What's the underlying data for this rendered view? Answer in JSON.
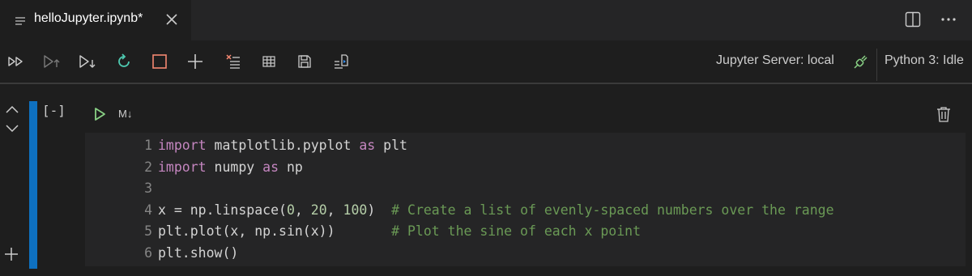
{
  "tab": {
    "title": "helloJupyter.ipynb*"
  },
  "toolbar": {
    "jupyter_server": "Jupyter Server: local",
    "kernel": "Python 3: Idle",
    "colors": {
      "restart": "#4ec9b0",
      "interrupt": "#f48771"
    }
  },
  "cell": {
    "execution_count": "[-]",
    "cell_type_toggle": "M↓",
    "code_lines": [
      {
        "number": "1",
        "tokens": [
          {
            "t": "import",
            "c": "kw"
          },
          {
            "t": " matplotlib.pyplot ",
            "c": ""
          },
          {
            "t": "as",
            "c": "kw"
          },
          {
            "t": " plt",
            "c": ""
          }
        ]
      },
      {
        "number": "2",
        "tokens": [
          {
            "t": "import",
            "c": "kw"
          },
          {
            "t": " numpy ",
            "c": ""
          },
          {
            "t": "as",
            "c": "kw"
          },
          {
            "t": " np",
            "c": ""
          }
        ]
      },
      {
        "number": "3",
        "tokens": []
      },
      {
        "number": "4",
        "tokens": [
          {
            "t": "x = np.linspace(",
            "c": ""
          },
          {
            "t": "0",
            "c": "num"
          },
          {
            "t": ", ",
            "c": ""
          },
          {
            "t": "20",
            "c": "num"
          },
          {
            "t": ", ",
            "c": ""
          },
          {
            "t": "100",
            "c": "num"
          },
          {
            "t": ")  ",
            "c": ""
          },
          {
            "t": "# Create a list of evenly-spaced numbers over the range",
            "c": "cmt"
          }
        ]
      },
      {
        "number": "5",
        "tokens": [
          {
            "t": "plt.plot(x, np.sin(x))       ",
            "c": ""
          },
          {
            "t": "# Plot the sine of each x point",
            "c": "cmt"
          }
        ]
      },
      {
        "number": "6",
        "tokens": [
          {
            "t": "plt.show()",
            "c": ""
          }
        ]
      }
    ]
  }
}
